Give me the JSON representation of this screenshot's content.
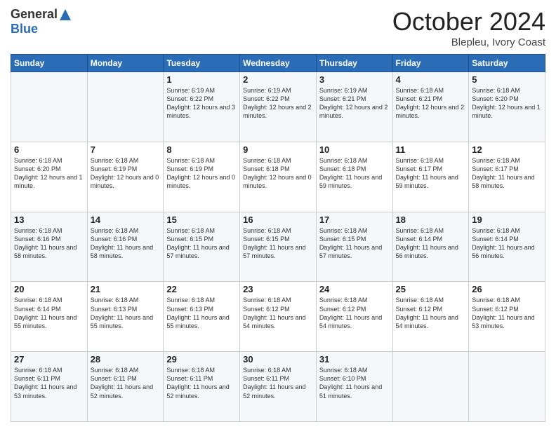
{
  "header": {
    "logo_general": "General",
    "logo_blue": "Blue",
    "month_title": "October 2024",
    "location": "Blepleu, Ivory Coast"
  },
  "days_of_week": [
    "Sunday",
    "Monday",
    "Tuesday",
    "Wednesday",
    "Thursday",
    "Friday",
    "Saturday"
  ],
  "weeks": [
    [
      {
        "day": "",
        "sunrise": "",
        "sunset": "",
        "daylight": ""
      },
      {
        "day": "",
        "sunrise": "",
        "sunset": "",
        "daylight": ""
      },
      {
        "day": "1",
        "sunrise": "6:19 AM",
        "sunset": "6:22 PM",
        "daylight": "12 hours and 3 minutes."
      },
      {
        "day": "2",
        "sunrise": "6:19 AM",
        "sunset": "6:22 PM",
        "daylight": "12 hours and 2 minutes."
      },
      {
        "day": "3",
        "sunrise": "6:19 AM",
        "sunset": "6:21 PM",
        "daylight": "12 hours and 2 minutes."
      },
      {
        "day": "4",
        "sunrise": "6:18 AM",
        "sunset": "6:21 PM",
        "daylight": "12 hours and 2 minutes."
      },
      {
        "day": "5",
        "sunrise": "6:18 AM",
        "sunset": "6:20 PM",
        "daylight": "12 hours and 1 minute."
      }
    ],
    [
      {
        "day": "6",
        "sunrise": "6:18 AM",
        "sunset": "6:20 PM",
        "daylight": "12 hours and 1 minute."
      },
      {
        "day": "7",
        "sunrise": "6:18 AM",
        "sunset": "6:19 PM",
        "daylight": "12 hours and 0 minutes."
      },
      {
        "day": "8",
        "sunrise": "6:18 AM",
        "sunset": "6:19 PM",
        "daylight": "12 hours and 0 minutes."
      },
      {
        "day": "9",
        "sunrise": "6:18 AM",
        "sunset": "6:18 PM",
        "daylight": "12 hours and 0 minutes."
      },
      {
        "day": "10",
        "sunrise": "6:18 AM",
        "sunset": "6:18 PM",
        "daylight": "11 hours and 59 minutes."
      },
      {
        "day": "11",
        "sunrise": "6:18 AM",
        "sunset": "6:17 PM",
        "daylight": "11 hours and 59 minutes."
      },
      {
        "day": "12",
        "sunrise": "6:18 AM",
        "sunset": "6:17 PM",
        "daylight": "11 hours and 58 minutes."
      }
    ],
    [
      {
        "day": "13",
        "sunrise": "6:18 AM",
        "sunset": "6:16 PM",
        "daylight": "11 hours and 58 minutes."
      },
      {
        "day": "14",
        "sunrise": "6:18 AM",
        "sunset": "6:16 PM",
        "daylight": "11 hours and 58 minutes."
      },
      {
        "day": "15",
        "sunrise": "6:18 AM",
        "sunset": "6:15 PM",
        "daylight": "11 hours and 57 minutes."
      },
      {
        "day": "16",
        "sunrise": "6:18 AM",
        "sunset": "6:15 PM",
        "daylight": "11 hours and 57 minutes."
      },
      {
        "day": "17",
        "sunrise": "6:18 AM",
        "sunset": "6:15 PM",
        "daylight": "11 hours and 57 minutes."
      },
      {
        "day": "18",
        "sunrise": "6:18 AM",
        "sunset": "6:14 PM",
        "daylight": "11 hours and 56 minutes."
      },
      {
        "day": "19",
        "sunrise": "6:18 AM",
        "sunset": "6:14 PM",
        "daylight": "11 hours and 56 minutes."
      }
    ],
    [
      {
        "day": "20",
        "sunrise": "6:18 AM",
        "sunset": "6:14 PM",
        "daylight": "11 hours and 55 minutes."
      },
      {
        "day": "21",
        "sunrise": "6:18 AM",
        "sunset": "6:13 PM",
        "daylight": "11 hours and 55 minutes."
      },
      {
        "day": "22",
        "sunrise": "6:18 AM",
        "sunset": "6:13 PM",
        "daylight": "11 hours and 55 minutes."
      },
      {
        "day": "23",
        "sunrise": "6:18 AM",
        "sunset": "6:12 PM",
        "daylight": "11 hours and 54 minutes."
      },
      {
        "day": "24",
        "sunrise": "6:18 AM",
        "sunset": "6:12 PM",
        "daylight": "11 hours and 54 minutes."
      },
      {
        "day": "25",
        "sunrise": "6:18 AM",
        "sunset": "6:12 PM",
        "daylight": "11 hours and 54 minutes."
      },
      {
        "day": "26",
        "sunrise": "6:18 AM",
        "sunset": "6:12 PM",
        "daylight": "11 hours and 53 minutes."
      }
    ],
    [
      {
        "day": "27",
        "sunrise": "6:18 AM",
        "sunset": "6:11 PM",
        "daylight": "11 hours and 53 minutes."
      },
      {
        "day": "28",
        "sunrise": "6:18 AM",
        "sunset": "6:11 PM",
        "daylight": "11 hours and 52 minutes."
      },
      {
        "day": "29",
        "sunrise": "6:18 AM",
        "sunset": "6:11 PM",
        "daylight": "11 hours and 52 minutes."
      },
      {
        "day": "30",
        "sunrise": "6:18 AM",
        "sunset": "6:11 PM",
        "daylight": "11 hours and 52 minutes."
      },
      {
        "day": "31",
        "sunrise": "6:18 AM",
        "sunset": "6:10 PM",
        "daylight": "11 hours and 51 minutes."
      },
      {
        "day": "",
        "sunrise": "",
        "sunset": "",
        "daylight": ""
      },
      {
        "day": "",
        "sunrise": "",
        "sunset": "",
        "daylight": ""
      }
    ]
  ]
}
